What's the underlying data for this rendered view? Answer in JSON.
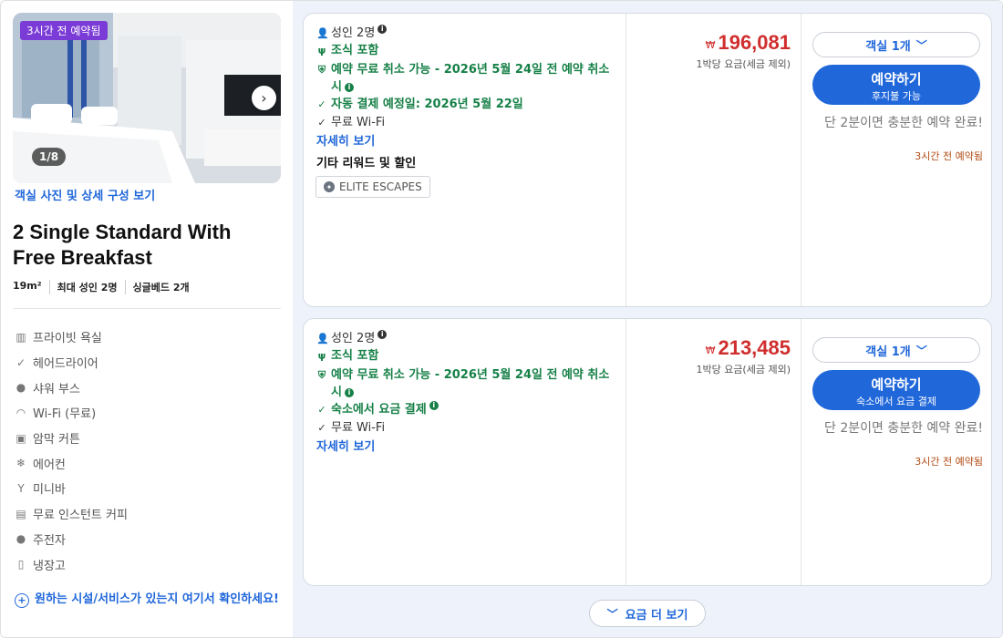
{
  "room": {
    "booked_badge": "3시간 전 예약됨",
    "photo_counter": "1/8",
    "photo_link": "객실 사진 및 상세 구성 보기",
    "title": "2 Single Standard With Free Breakfast",
    "specs": [
      "19m²",
      "최대 성인 2명",
      "싱글베드 2개"
    ],
    "amenities": [
      {
        "icon": "private-bathroom-icon",
        "label": "프라이빗 욕실"
      },
      {
        "icon": "check-icon",
        "label": "헤어드라이어"
      },
      {
        "icon": "check-circle-icon",
        "label": "샤워 부스"
      },
      {
        "icon": "wifi-icon",
        "label": "Wi-Fi (무료)"
      },
      {
        "icon": "blackout-curtain-icon",
        "label": "암막 커튼"
      },
      {
        "icon": "air-conditioner-icon",
        "label": "에어컨"
      },
      {
        "icon": "minibar-icon",
        "label": "미니바"
      },
      {
        "icon": "coffee-maker-icon",
        "label": "무료 인스턴트 커피"
      },
      {
        "icon": "check-circle-icon",
        "label": "주전자"
      },
      {
        "icon": "fridge-icon",
        "label": "냉장고"
      }
    ],
    "ask_link": "원하는 시설/서비스가 있는지 여기서 확인하세요!"
  },
  "offers": [
    {
      "guests": "성인 2명",
      "breakfast": "조식 포함",
      "cancel": "예약 무료 취소 가능 - 2026년 5월 24일 전 예약 취소 시",
      "payment": "자동 결제 예정일: 2026년 5월 22일",
      "wifi": "무료 Wi-Fi",
      "details_link": "자세히 보기",
      "rewards_title": "기타 리워드 및 할인",
      "rewards_badge": "ELITE ESCAPES",
      "currency": "₩",
      "price": "196,081",
      "price_note": "1박당 요금(세금 제외)",
      "room_qty": "객실 1개",
      "book_label": "예약하기",
      "book_sub": "후지불 가능",
      "promo": "단 2분이면 충분한 예약 완료!",
      "booked_ago": "3시간 전 예약됨"
    },
    {
      "guests": "성인 2명",
      "breakfast": "조식 포함",
      "cancel": "예약 무료 취소 가능 - 2026년 5월 24일 전 예약 취소 시",
      "payment": "숙소에서 요금 결제",
      "wifi": "무료 Wi-Fi",
      "details_link": "자세히 보기",
      "currency": "₩",
      "price": "213,485",
      "price_note": "1박당 요금(세금 제외)",
      "room_qty": "객실 1개",
      "book_label": "예약하기",
      "book_sub": "숙소에서 요금 결제",
      "promo": "단 2분이면 충분한 예약 완료!",
      "booked_ago": "3시간 전 예약됨"
    }
  ],
  "more_rates": "요금 더 보기",
  "colors": {
    "accent": "#2067da",
    "price": "#d02e2e",
    "benefit": "#168047",
    "badge": "#7a3bd6",
    "booked": "#b24a12"
  }
}
